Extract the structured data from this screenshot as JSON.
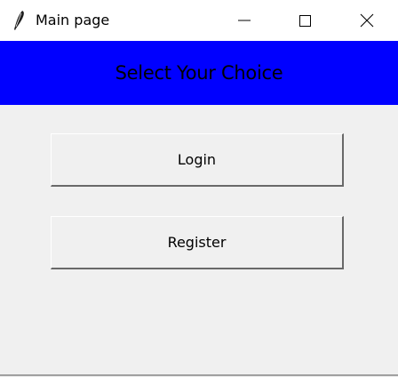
{
  "window": {
    "title": "Main page",
    "icon": "feather-icon"
  },
  "banner": {
    "title": "Select Your Choice",
    "background_color": "#0000ff"
  },
  "buttons": {
    "login_label": "Login",
    "register_label": "Register"
  },
  "window_controls": [
    "minimize-icon",
    "maximize-icon",
    "close-icon"
  ]
}
